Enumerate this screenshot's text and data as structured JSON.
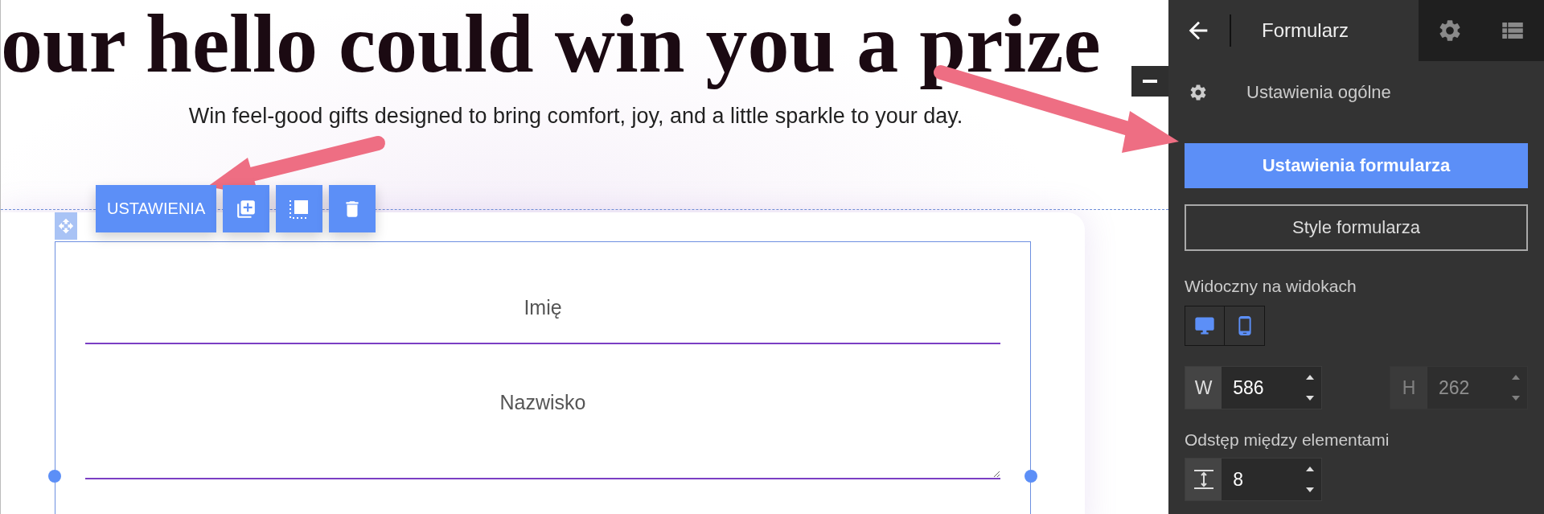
{
  "canvas": {
    "headline": "our hello could win you a prize",
    "subtitle": "Win feel-good gifts designed to bring comfort, joy, and a little sparkle to your day.",
    "toolbar": {
      "settings_label": "USTAWIENIA"
    },
    "form": {
      "fields": [
        {
          "kind": "input",
          "placeholder": "Imię"
        },
        {
          "kind": "textarea",
          "placeholder": "Nazwisko"
        }
      ]
    }
  },
  "panel": {
    "title": "Formularz",
    "section": "Ustawienia ogólne",
    "tabs": [
      {
        "label": "Ustawienia formularza",
        "selected": true
      },
      {
        "label": "Style formularza",
        "selected": false
      }
    ],
    "visibility": {
      "label": "Widoczny na widokach",
      "devices": [
        {
          "kind": "desktop",
          "selected": true
        },
        {
          "kind": "mobile",
          "selected": true
        }
      ]
    },
    "width": {
      "label": "W",
      "value": "586",
      "disabled": false
    },
    "height": {
      "label": "H",
      "value": "262",
      "disabled": true
    },
    "spacing": {
      "label": "Odstęp między elementami",
      "value": "8"
    }
  }
}
